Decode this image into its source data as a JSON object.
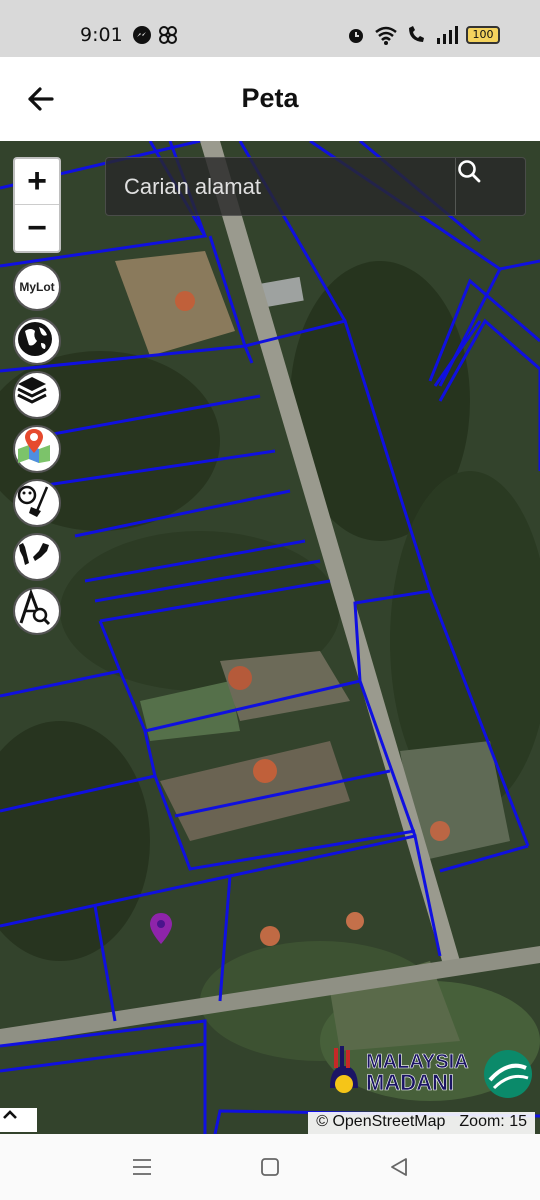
{
  "status_bar": {
    "time": "9:01",
    "battery": "100",
    "icons": [
      "messenger-icon",
      "pinwheel-icon",
      "alarm-icon",
      "wifi-icon",
      "wifi-call-icon",
      "signal-icon",
      "battery-icon"
    ]
  },
  "header": {
    "title": "Peta",
    "back_icon": "arrow-left-icon"
  },
  "map": {
    "zoom_in_label": "+",
    "zoom_out_label": "−",
    "tools": [
      {
        "name": "mylot-button",
        "label": "MyLot"
      },
      {
        "name": "globe-button",
        "icon": "globe-icon"
      },
      {
        "name": "layers-button",
        "icon": "layers-icon"
      },
      {
        "name": "map-pin-button",
        "icon": "map-pin-icon"
      },
      {
        "name": "clear-button",
        "icon": "broom-icon"
      },
      {
        "name": "malaysia-button",
        "icon": "malaysia-map-icon"
      },
      {
        "name": "measure-button",
        "icon": "measure-search-icon"
      }
    ],
    "search": {
      "placeholder": "Carian alamat",
      "value": ""
    },
    "marker_color": "#8e24aa",
    "parcel_line_color": "#1010e0",
    "logo": {
      "line1": "MALAYSIA",
      "line2": "MADANI"
    },
    "attribution": "© OpenStreetMap",
    "zoom_text": "Zoom: 15"
  },
  "nav": {
    "buttons": [
      "menu-icon",
      "home-icon",
      "back-icon"
    ]
  }
}
